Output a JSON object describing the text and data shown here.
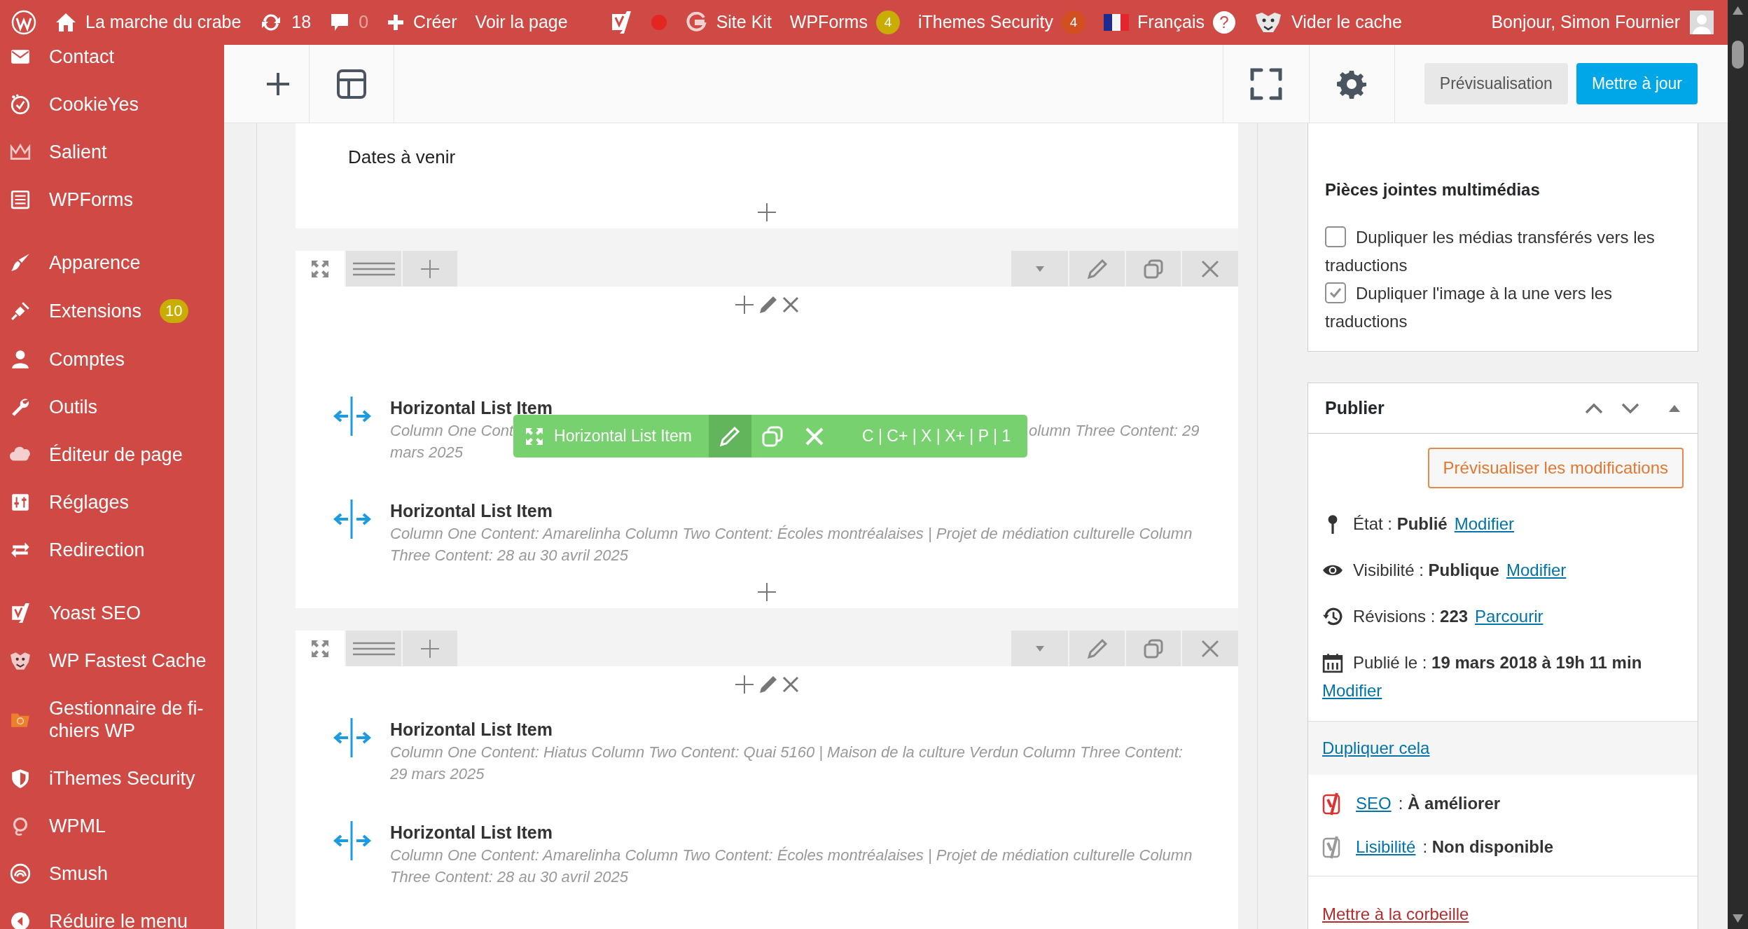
{
  "admin_bar": {
    "items": [
      {
        "kind": "logo"
      },
      {
        "kind": "site",
        "label": "La marche du crabe"
      },
      {
        "kind": "updates",
        "label": "18"
      },
      {
        "kind": "comments",
        "label": "0"
      },
      {
        "kind": "new",
        "label": "Créer"
      },
      {
        "kind": "link",
        "label": "Voir la page"
      },
      {
        "kind": "seo"
      },
      {
        "kind": "dot"
      },
      {
        "kind": "sitekit",
        "label": "Site Kit"
      },
      {
        "kind": "plugin",
        "label": "WPForms",
        "badge": {
          "text": "4",
          "color": "#c9ad05"
        }
      },
      {
        "kind": "plugin",
        "label": "iThemes Security",
        "badge": {
          "text": "4",
          "color": "#d2501f"
        }
      },
      {
        "kind": "language",
        "label": "Français",
        "help": "?"
      },
      {
        "kind": "cache",
        "label": "Vider le cache"
      },
      {
        "kind": "account",
        "label": "Bonjour, Simon Fournier"
      }
    ]
  },
  "sidebar": {
    "groups": [
      [
        {
          "label": "Contact"
        },
        {
          "label": "CookieYes"
        },
        {
          "label": "Salient"
        },
        {
          "label": "WPForms"
        }
      ],
      [
        {
          "label": "Apparence"
        },
        {
          "label": "Extensions",
          "badge": "10"
        },
        {
          "label": "Comptes"
        },
        {
          "label": "Outils"
        },
        {
          "label": "Éditeur de page"
        },
        {
          "label": "Réglages"
        },
        {
          "label": "Redirection"
        }
      ],
      [
        {
          "label": "Yoast SEO"
        },
        {
          "label": "WP Fastest Cache"
        },
        {
          "label": "Gestionnaire de fi-chiers WP"
        },
        {
          "label": "iThemes Security"
        },
        {
          "label": "WPML"
        },
        {
          "label": "Smush"
        },
        {
          "label": "Réduire le menu"
        }
      ]
    ]
  },
  "editor_toolbar": {
    "preview": "Prévisualisation",
    "update": "Mettre à jour"
  },
  "content": {
    "text_block": "Dates à venir",
    "sections": [
      {
        "toolbar": {
          "label": "Horizontal List Item",
          "shortcuts": "C | C+ | X | X+ | P | 1"
        },
        "items": [
          {
            "kind": "covered",
            "title": "Horizontal List Item",
            "description_before": "Column One Cont",
            "description_after": "olumn Three Content: 29",
            "description_wrap": "mars 2025"
          },
          {
            "kind": "plain",
            "title": "Horizontal List Item",
            "description": "Column One Content: Amarelinha  Column Two Content: Écoles montréalaises | Projet de médiation culturelle  Column Three Content: 28 au 30 avril 2025"
          }
        ]
      },
      {
        "items": [
          {
            "kind": "plain",
            "title": "Horizontal List Item",
            "description": "Column One Content: Hiatus  Column Two Content: Quai 5160 | Maison de la culture Verdun  Column Three Content: 29 mars 2025"
          },
          {
            "kind": "plain",
            "title": "Horizontal List Item",
            "description": "Column One Content: Amarelinha  Column Two Content: Écoles montréalaises | Projet de médiation culturelle  Column Three Content: 28 au 30 avril 2025"
          }
        ]
      }
    ]
  },
  "right_panel": {
    "media": {
      "title": "Pièces jointes multimédias",
      "options": [
        {
          "label": "Dupliquer les médias transférés vers les traductions",
          "checked": false
        },
        {
          "label": "Dupliquer l'image à la une vers les traductions",
          "checked": true
        }
      ]
    },
    "publish": {
      "title": "Publier",
      "preview_button": "Prévisualiser les modifications",
      "rows": [
        {
          "kind": "status",
          "text": "État : **Publié**",
          "link": "Modifier"
        },
        {
          "kind": "visibility",
          "text": "Visibilité : **Publique**",
          "link": "Modifier"
        },
        {
          "kind": "revisions",
          "text": "Révisions : **223**",
          "link": "Parcourir"
        },
        {
          "kind": "date",
          "text": "Publié le : **19 mars 2018 à 19h 11 min**",
          "link": "Modifier"
        }
      ],
      "duplicate_link": "Dupliquer cela",
      "scores": [
        {
          "kind": "seo",
          "link": "SEO",
          "text": ": **À améliorer**"
        },
        {
          "kind": "readability",
          "link": "Lisibilité",
          "text": ": **Non disponible**"
        }
      ],
      "trash_link": "Mettre à la corbeille"
    }
  }
}
